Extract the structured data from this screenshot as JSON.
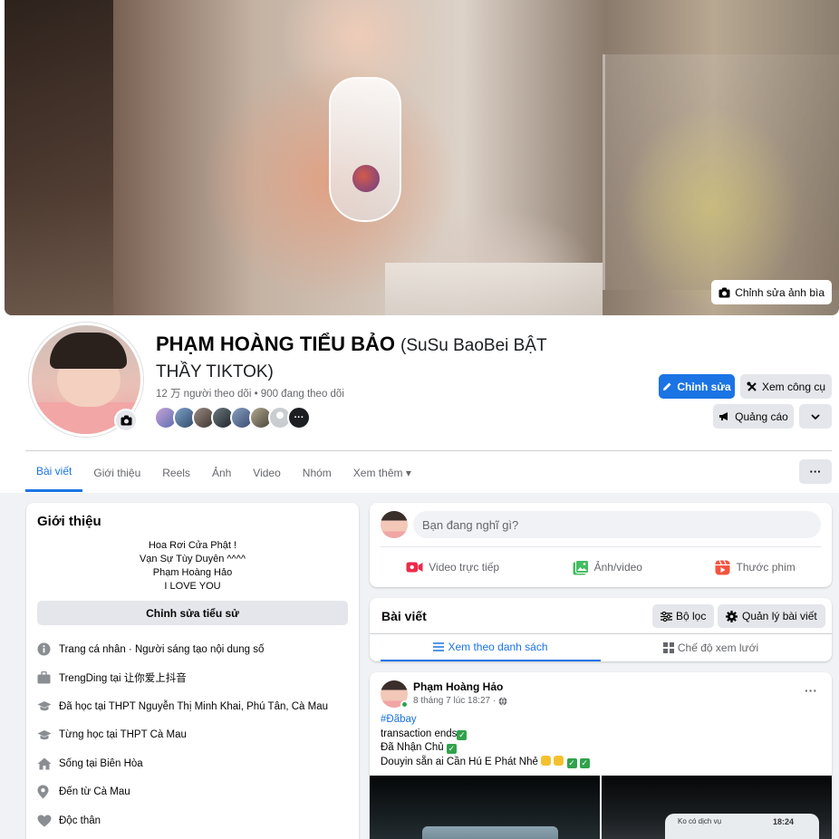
{
  "cover": {
    "edit_label": "Chỉnh sửa ảnh bìa"
  },
  "profile": {
    "name": "PHẠM HOÀNG TIỂU BẢO",
    "alt_name": "(SuSu BaoBei BẬT THẦY TIKTOK)",
    "followers_text": "12 万 người theo dõi • 900 đang theo dõi",
    "friends_more": "···"
  },
  "actions": {
    "edit_label": "Chỉnh sửa",
    "tools_label": "Xem công cụ",
    "ads_label": "Quảng cáo"
  },
  "tabs": [
    {
      "label": "Bài viết"
    },
    {
      "label": "Giới thiệu"
    },
    {
      "label": "Reels"
    },
    {
      "label": "Ảnh"
    },
    {
      "label": "Video"
    },
    {
      "label": "Nhóm"
    },
    {
      "label": "Xem thêm ▾"
    }
  ],
  "tabs_more_label": "···",
  "intro": {
    "title": "Giới thiệu",
    "bio_lines": [
      "Hoa Rơi Cửa Phật !",
      "Vạn Sự Tùy Duyên ^^^^",
      "Phạm Hoàng Hảo",
      "I LOVE YOU"
    ],
    "edit_bio_label": "Chỉnh sửa tiểu sử",
    "items": [
      {
        "icon": "info-icon",
        "text": "Trang cá nhân · Người sáng tạo nội dung số"
      },
      {
        "icon": "briefcase-icon",
        "text": "TrengDing tại 让你爱上抖音"
      },
      {
        "icon": "graduation-cap-icon",
        "text": "Đã học tại THPT Nguyễn Thị Minh Khai, Phú Tân, Cà Mau"
      },
      {
        "icon": "graduation-cap-icon",
        "text": "Từng học tại THPT Cà Mau"
      },
      {
        "icon": "home-icon",
        "text": "Sống tại Biên Hòa"
      },
      {
        "icon": "location-pin-icon",
        "text": "Đến từ Cà Mau"
      },
      {
        "icon": "heart-icon",
        "text": "Độc thân"
      }
    ]
  },
  "composer": {
    "placeholder": "Bạn đang nghĩ gì?",
    "live_label": "Video trực tiếp",
    "photo_label": "Ảnh/video",
    "reel_label": "Thước phim"
  },
  "posts_section": {
    "title": "Bài viết",
    "filter_label": "Bộ lọc",
    "manage_label": "Quản lý bài viết",
    "list_view_label": "Xem theo danh sách",
    "grid_view_label": "Chế độ xem lưới"
  },
  "post": {
    "author": "Phạm Hoàng Hảo",
    "time": "8 tháng 7 lúc 18:27 ·",
    "hashtag": "#Đãbay",
    "line1": "transaction ends",
    "line2": "Đã Nhận Chủ",
    "line3": "Douyin sẵn ai Cần Hú E Phát Nhẻ",
    "image2_status": "Ko có dịch vụ",
    "image2_clock": "18:24"
  },
  "colors": {
    "accent": "#1b74e4",
    "page_bg": "#f0f2f5",
    "button_gray": "#e4e6eb",
    "text_secondary": "#65676b"
  }
}
